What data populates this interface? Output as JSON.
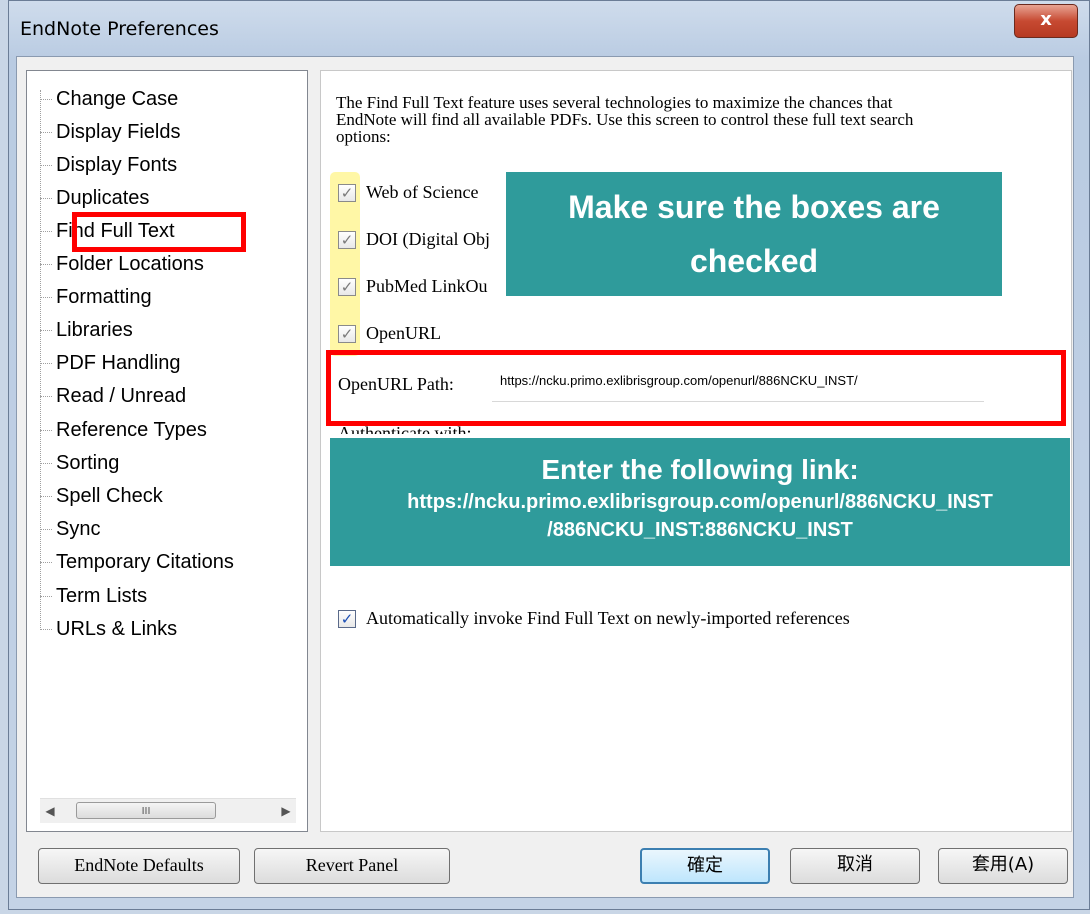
{
  "window": {
    "title": "EndNote Preferences",
    "close_label": "x"
  },
  "tree": {
    "items": [
      {
        "label": "Change Case"
      },
      {
        "label": "Display Fields"
      },
      {
        "label": "Display Fonts"
      },
      {
        "label": "Duplicates"
      },
      {
        "label": "Find Full Text",
        "selected": true
      },
      {
        "label": "Folder Locations"
      },
      {
        "label": "Formatting"
      },
      {
        "label": "Libraries"
      },
      {
        "label": "PDF Handling"
      },
      {
        "label": "Read / Unread"
      },
      {
        "label": "Reference Types"
      },
      {
        "label": "Sorting"
      },
      {
        "label": "Spell Check"
      },
      {
        "label": "Sync"
      },
      {
        "label": "Temporary Citations"
      },
      {
        "label": "Term Lists"
      },
      {
        "label": "URLs & Links"
      }
    ],
    "scroll_thumb": "III"
  },
  "panel": {
    "description": "The Find Full Text feature uses several technologies to maximize the chances that EndNote will find all available PDFs. Use this screen to control these full text search options:",
    "checkboxes": [
      {
        "label": "Web of Science",
        "checked": true
      },
      {
        "label": "DOI (Digital Obj",
        "checked": true
      },
      {
        "label": "PubMed LinkOu",
        "checked": true
      },
      {
        "label": "OpenURL",
        "checked": true
      }
    ],
    "openurl_path_label": "OpenURL Path:",
    "openurl_path_value": "https://ncku.primo.exlibrisgroup.com/openurl/886NCKU_INST/",
    "authenticate_label": "Authenticate with:",
    "auto_invoke_label": "Automatically invoke Find Full Text on newly-imported references",
    "auto_invoke_checked": true
  },
  "callouts": {
    "boxes_checked": "Make sure the boxes are checked",
    "link_heading": "Enter the following link:",
    "link_line1": "https://ncku.primo.exlibrisgroup.com/openurl/886NCKU_INST",
    "link_line2": "/886NCKU_INST:886NCKU_INST"
  },
  "buttons": {
    "endnote_defaults": "EndNote Defaults",
    "revert_panel": "Revert Panel",
    "ok": "確定",
    "cancel": "取消",
    "apply": "套用(A)"
  },
  "colors": {
    "callout": "#2f9b9b",
    "highlight_red": "#ff0000",
    "highlight_yellow": "#fff7a6"
  }
}
